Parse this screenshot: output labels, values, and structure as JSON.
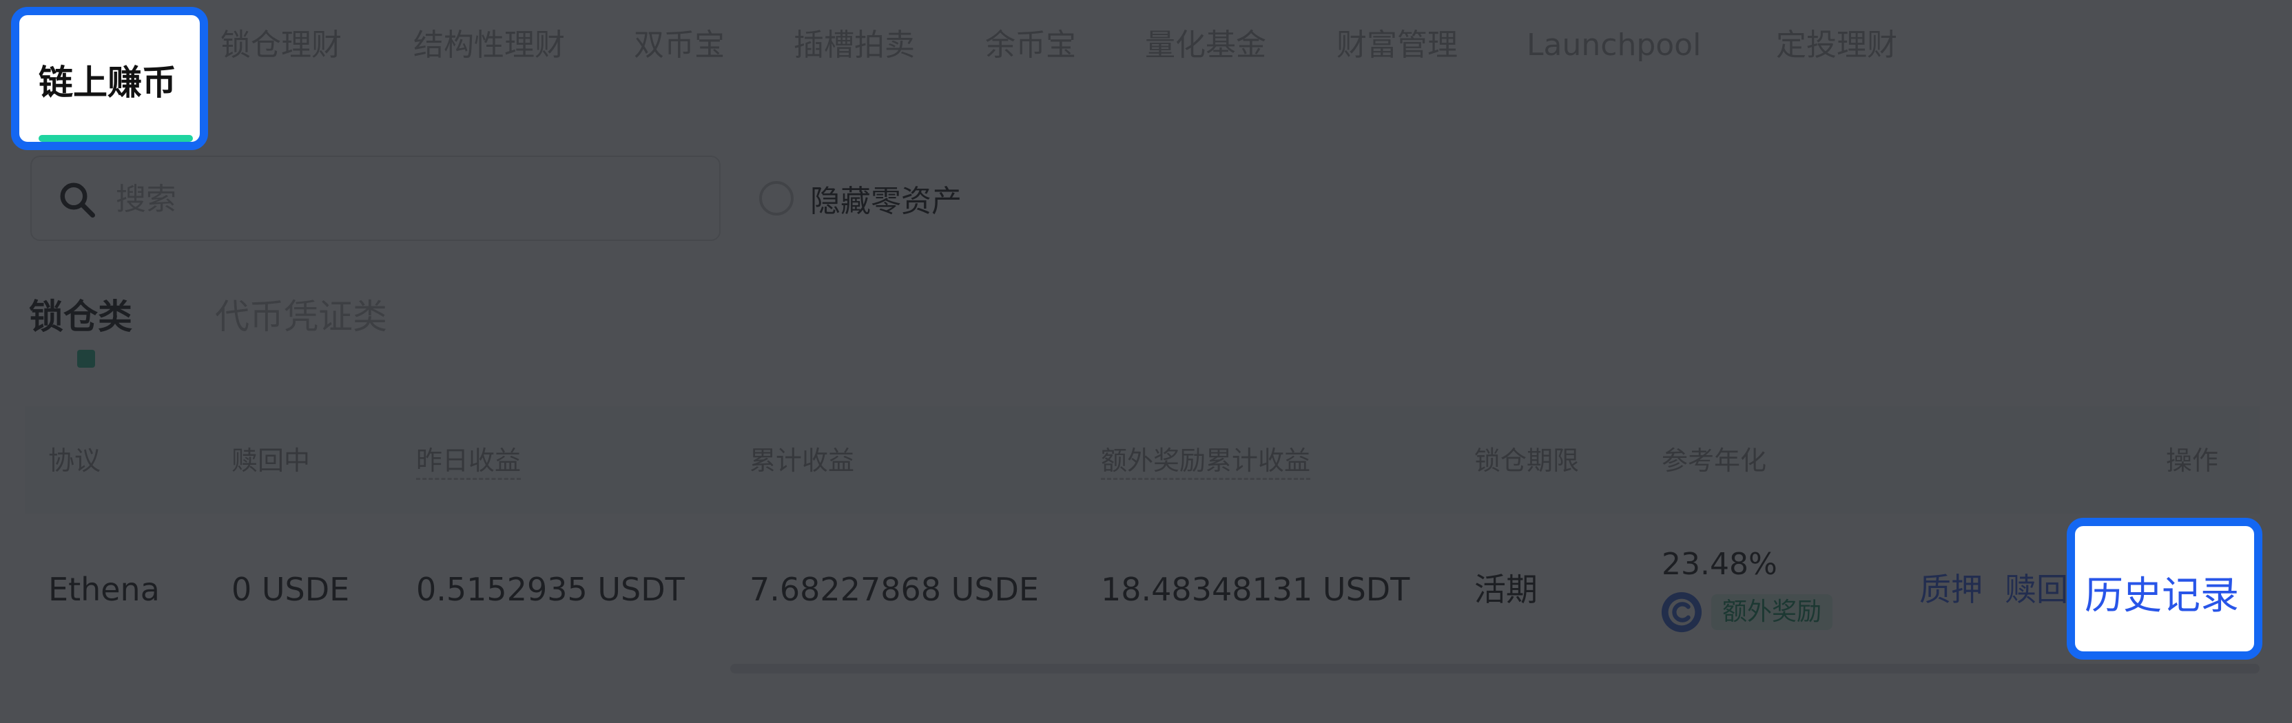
{
  "top_tabs": {
    "active": "链上赚币",
    "items": [
      "锁仓理财",
      "结构性理财",
      "双币宝",
      "插槽拍卖",
      "余币宝",
      "量化基金",
      "财富管理",
      "Launchpool",
      "定投理财"
    ]
  },
  "search": {
    "placeholder": "搜索",
    "value": ""
  },
  "hide_zero": {
    "label": "隐藏零资产",
    "checked": false
  },
  "sub_tabs": {
    "active": "锁仓类",
    "inactive": "代币凭证类"
  },
  "table": {
    "headers": [
      "协议",
      "赎回中",
      "昨日收益",
      "累计收益",
      "额外奖励累计收益",
      "锁仓期限",
      "参考年化",
      "操作"
    ],
    "rows": [
      {
        "protocol": "Ethena",
        "redeeming": "0 USDE",
        "yesterday_earnings": "0.5152935 USDT",
        "total_earnings": "7.68227868 USDE",
        "bonus_total_earnings": "18.48348131 USDT",
        "lock_period": "活期",
        "apy": "23.48%",
        "bonus_badge": "额外奖励",
        "actions": {
          "pledge": "质押",
          "redeem": "赎回",
          "history": "历史记录"
        }
      }
    ]
  },
  "icons": {
    "search": "search-icon",
    "bonus": "bonus-coin-icon"
  },
  "colors": {
    "highlight_border": "#1467f2",
    "active_underline": "#1fd4a0",
    "link": "#2855e8",
    "badge_bg": "#d4f5e6",
    "badge_text": "#0c8a5a"
  }
}
